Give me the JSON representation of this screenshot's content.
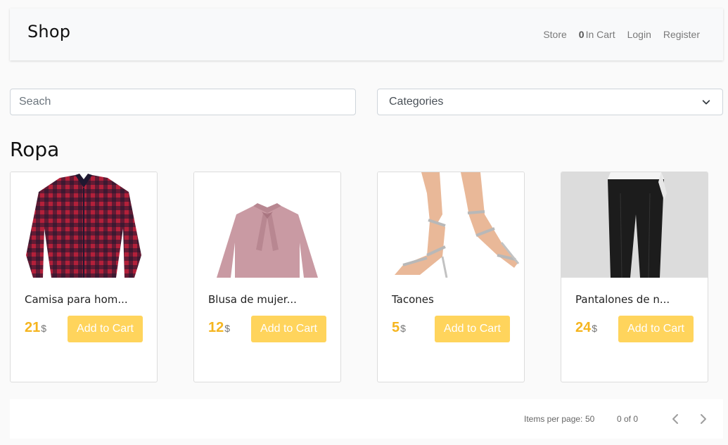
{
  "navbar": {
    "brand": "Shop",
    "store_label": "Store",
    "cart_count": "0",
    "cart_label": "In Cart",
    "login_label": "Login",
    "register_label": "Register"
  },
  "filters": {
    "search_placeholder": "Seach",
    "category_selected": "Categories"
  },
  "section": {
    "title": "Ropa"
  },
  "products": [
    {
      "name": "Camisa para hom...",
      "price": "21",
      "currency": "$",
      "button": "Add to Cart",
      "image": "plaid-shirt"
    },
    {
      "name": "Blusa de mujer...",
      "price": "12",
      "currency": "$",
      "button": "Add to Cart",
      "image": "pink-blouse"
    },
    {
      "name": "Tacones",
      "price": "5",
      "currency": "$",
      "button": "Add to Cart",
      "image": "silver-heels"
    },
    {
      "name": "Pantalones de n...",
      "price": "24",
      "currency": "$",
      "button": "Add to Cart",
      "image": "black-pants"
    }
  ],
  "paginator": {
    "items_per_page_label": "Items per page:",
    "page_size": "50",
    "range_label": "0 of 0"
  },
  "colors": {
    "price": "#f5b51f",
    "button": "#ffd45c",
    "shirt_red": "#b3203a",
    "shirt_dark": "#1f1830"
  }
}
